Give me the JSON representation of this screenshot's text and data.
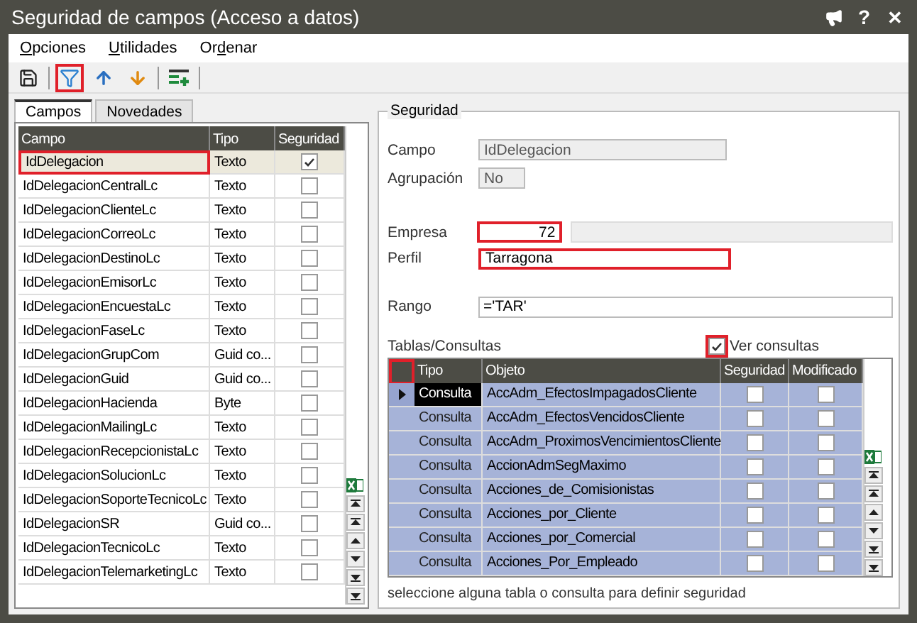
{
  "window": {
    "title": "Seguridad de campos (Acceso a datos)",
    "controls": [
      {
        "kind": "help",
        "label": "?"
      },
      {
        "kind": "close",
        "label": "✕"
      }
    ]
  },
  "menu": [
    {
      "key": "O",
      "after": "pciones"
    },
    {
      "key": "U",
      "after": "tilidades"
    },
    {
      "before": "Or",
      "key": "d",
      "after": "enar"
    }
  ],
  "toolbar": [
    {
      "kind": "save",
      "highlighted": false
    },
    {
      "kind": "filter",
      "highlighted": true
    },
    {
      "kind": "up",
      "highlighted": false
    },
    {
      "kind": "down",
      "highlighted": false
    },
    {
      "kind": "add",
      "highlighted": false
    }
  ],
  "tabs": [
    {
      "label": "Campos",
      "selected": true
    },
    {
      "label": "Novedades",
      "selected": false
    }
  ],
  "fields": {
    "columns": [
      "Campo",
      "Tipo",
      "Seguridad"
    ],
    "rows": [
      {
        "campo": "IdDelegacion",
        "tipo": "Texto",
        "seguridad": true,
        "selected": true,
        "highlighted": true
      },
      {
        "campo": "IdDelegacionCentralLc",
        "tipo": "Texto",
        "seguridad": false,
        "selected": false,
        "highlighted": false
      },
      {
        "campo": "IdDelegacionClienteLc",
        "tipo": "Texto",
        "seguridad": false,
        "selected": false,
        "highlighted": false
      },
      {
        "campo": "IdDelegacionCorreoLc",
        "tipo": "Texto",
        "seguridad": false,
        "selected": false,
        "highlighted": false
      },
      {
        "campo": "IdDelegacionDestinoLc",
        "tipo": "Texto",
        "seguridad": false,
        "selected": false,
        "highlighted": false
      },
      {
        "campo": "IdDelegacionEmisorLc",
        "tipo": "Texto",
        "seguridad": false,
        "selected": false,
        "highlighted": false
      },
      {
        "campo": "IdDelegacionEncuestaLc",
        "tipo": "Texto",
        "seguridad": false,
        "selected": false,
        "highlighted": false
      },
      {
        "campo": "IdDelegacionFaseLc",
        "tipo": "Texto",
        "seguridad": false,
        "selected": false,
        "highlighted": false
      },
      {
        "campo": "IdDelegacionGrupCom",
        "tipo": "Guid co...",
        "seguridad": false,
        "selected": false,
        "highlighted": false
      },
      {
        "campo": "IdDelegacionGuid",
        "tipo": "Guid co...",
        "seguridad": false,
        "selected": false,
        "highlighted": false
      },
      {
        "campo": "IdDelegacionHacienda",
        "tipo": "Byte",
        "seguridad": false,
        "selected": false,
        "highlighted": false
      },
      {
        "campo": "IdDelegacionMailingLc",
        "tipo": "Texto",
        "seguridad": false,
        "selected": false,
        "highlighted": false
      },
      {
        "campo": "IdDelegacionRecepcionistaLc",
        "tipo": "Texto",
        "seguridad": false,
        "selected": false,
        "highlighted": false
      },
      {
        "campo": "IdDelegacionSolucionLc",
        "tipo": "Texto",
        "seguridad": false,
        "selected": false,
        "highlighted": false
      },
      {
        "campo": "IdDelegacionSoporteTecnicoLc",
        "tipo": "Texto",
        "seguridad": false,
        "selected": false,
        "highlighted": false
      },
      {
        "campo": "IdDelegacionSR",
        "tipo": "Guid co...",
        "seguridad": false,
        "selected": false,
        "highlighted": false
      },
      {
        "campo": "IdDelegacionTecnicoLc",
        "tipo": "Texto",
        "seguridad": false,
        "selected": false,
        "highlighted": false
      },
      {
        "campo": "IdDelegacionTelemarketingLc",
        "tipo": "Texto",
        "seguridad": false,
        "selected": false,
        "highlighted": false
      }
    ]
  },
  "seguridad": {
    "title": "Seguridad",
    "campo": {
      "label": "Campo",
      "value": "IdDelegacion"
    },
    "agrupacion": {
      "label": "Agrupación",
      "value": "No"
    },
    "empresa": {
      "label": "Empresa",
      "value": "72",
      "highlighted": true
    },
    "perfil": {
      "label": "Perfil",
      "value": "Tarragona",
      "highlighted": true
    },
    "rango": {
      "label": "Rango",
      "value": "='TAR'"
    },
    "objects_label": "Tablas/Consultas",
    "ver_consultas": {
      "label": "Ver consultas",
      "checked": true,
      "highlighted": true
    },
    "objects": {
      "columns": [
        "Tipo",
        "Objeto",
        "Seguridad",
        "Modificado"
      ],
      "corner_highlighted": true,
      "rows": [
        {
          "tipo": "Consulta",
          "objeto": "AccAdm_EfectosImpagadosCliente",
          "seguridad": false,
          "modificado": false,
          "selected": true
        },
        {
          "tipo": "Consulta",
          "objeto": "AccAdm_EfectosVencidosCliente",
          "seguridad": false,
          "modificado": false,
          "selected": false
        },
        {
          "tipo": "Consulta",
          "objeto": "AccAdm_ProximosVencimientosCliente",
          "seguridad": false,
          "modificado": false,
          "selected": false
        },
        {
          "tipo": "Consulta",
          "objeto": "AccionAdmSegMaximo",
          "seguridad": false,
          "modificado": false,
          "selected": false
        },
        {
          "tipo": "Consulta",
          "objeto": "Acciones_de_Comisionistas",
          "seguridad": false,
          "modificado": false,
          "selected": false
        },
        {
          "tipo": "Consulta",
          "objeto": "Acciones_por_Cliente",
          "seguridad": false,
          "modificado": false,
          "selected": false
        },
        {
          "tipo": "Consulta",
          "objeto": "Acciones_por_Comercial",
          "seguridad": false,
          "modificado": false,
          "selected": false
        },
        {
          "tipo": "Consulta",
          "objeto": "Acciones_Por_Empleado",
          "seguridad": false,
          "modificado": false,
          "selected": false
        }
      ]
    },
    "hint": "seleccione alguna tabla o consulta para definir seguridad"
  }
}
